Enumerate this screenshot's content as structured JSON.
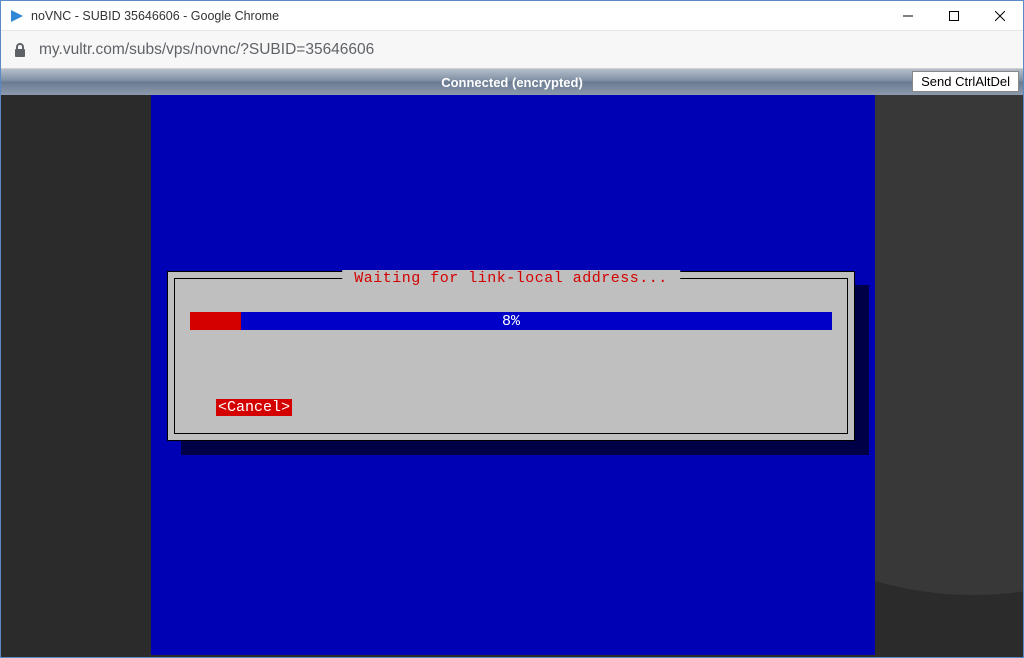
{
  "chrome": {
    "title": "noVNC - SUBID 35646606 - Google Chrome",
    "url": "my.vultr.com/subs/vps/novnc/?SUBID=35646606"
  },
  "vnc": {
    "status": "Connected (encrypted)",
    "ctrl_alt_del_label": "Send CtrlAltDel"
  },
  "dialog": {
    "title": "Waiting for link-local address...",
    "progress_percent": 8,
    "progress_label": "8%",
    "cancel_label": "<Cancel>"
  },
  "colors": {
    "vnc_blue": "#0000b4",
    "dialog_gray": "#bfbfbf",
    "accent_red": "#d40000",
    "progress_blue": "#0000c8"
  }
}
